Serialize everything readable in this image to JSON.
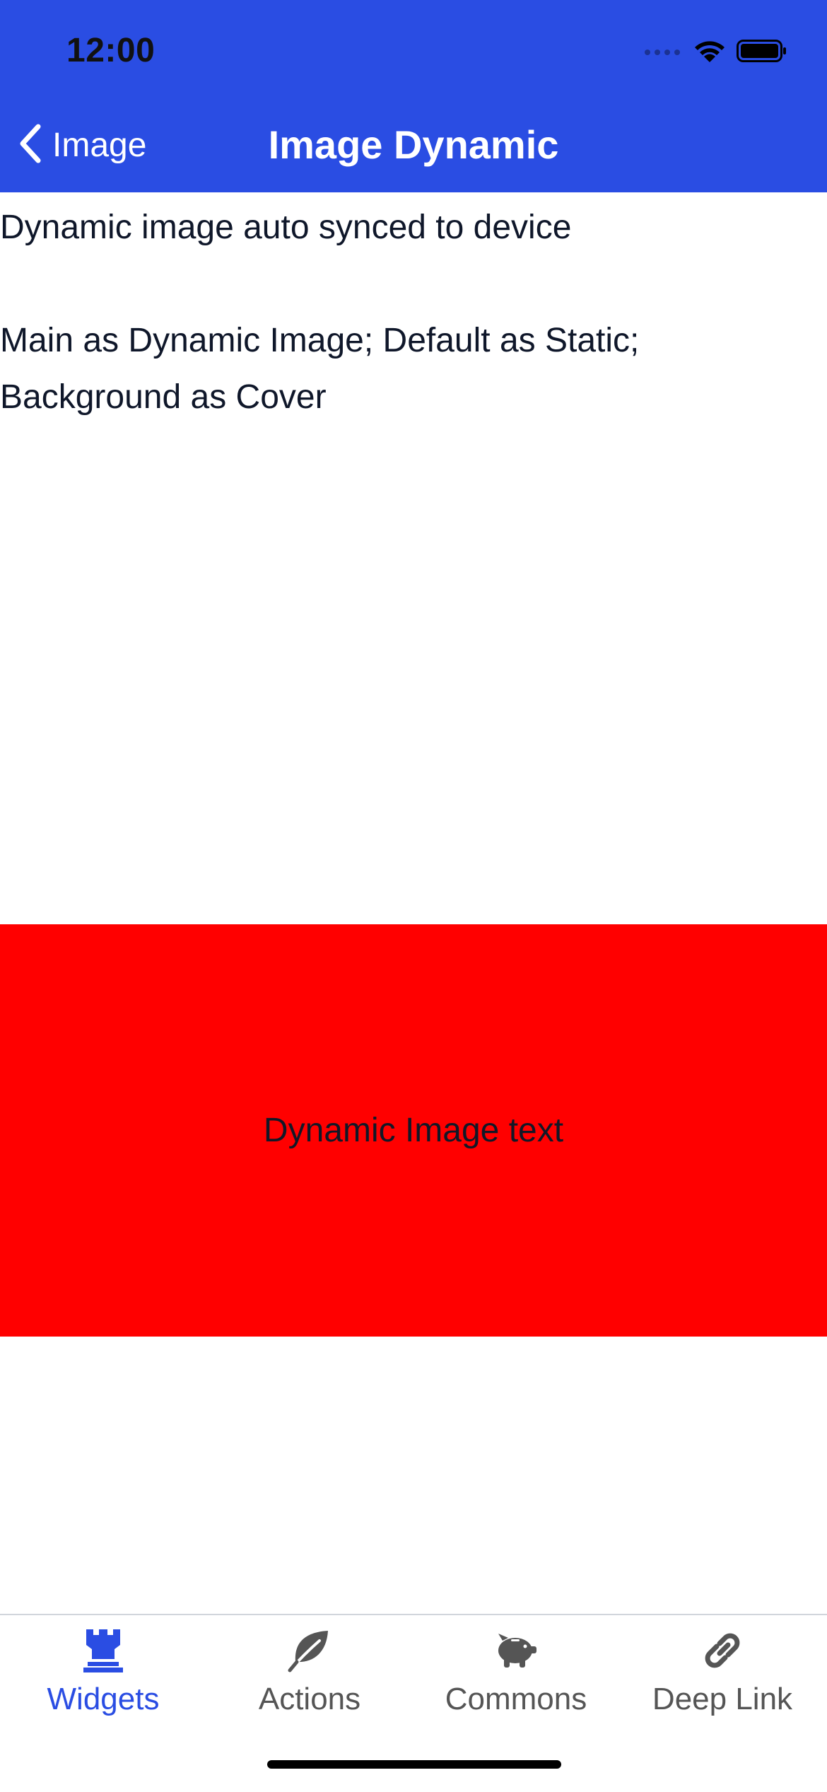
{
  "status_bar": {
    "time": "12:00"
  },
  "nav": {
    "back_label": "Image",
    "title": "Image Dynamic"
  },
  "content": {
    "line1": "Dynamic image auto synced to device",
    "line2": "Main as Dynamic Image; Default as Static;",
    "line3": "Background as Cover",
    "image_text": "Dynamic Image text"
  },
  "tabs": [
    {
      "label": "Widgets",
      "icon": "rook-icon",
      "active": true
    },
    {
      "label": "Actions",
      "icon": "leaf-icon",
      "active": false
    },
    {
      "label": "Commons",
      "icon": "piggy-bank-icon",
      "active": false
    },
    {
      "label": "Deep Link",
      "icon": "link-icon",
      "active": false
    }
  ],
  "colors": {
    "header": "#2a4de3",
    "image_background": "#ff0000",
    "tab_active": "#2a4de3",
    "tab_inactive": "#555555"
  }
}
